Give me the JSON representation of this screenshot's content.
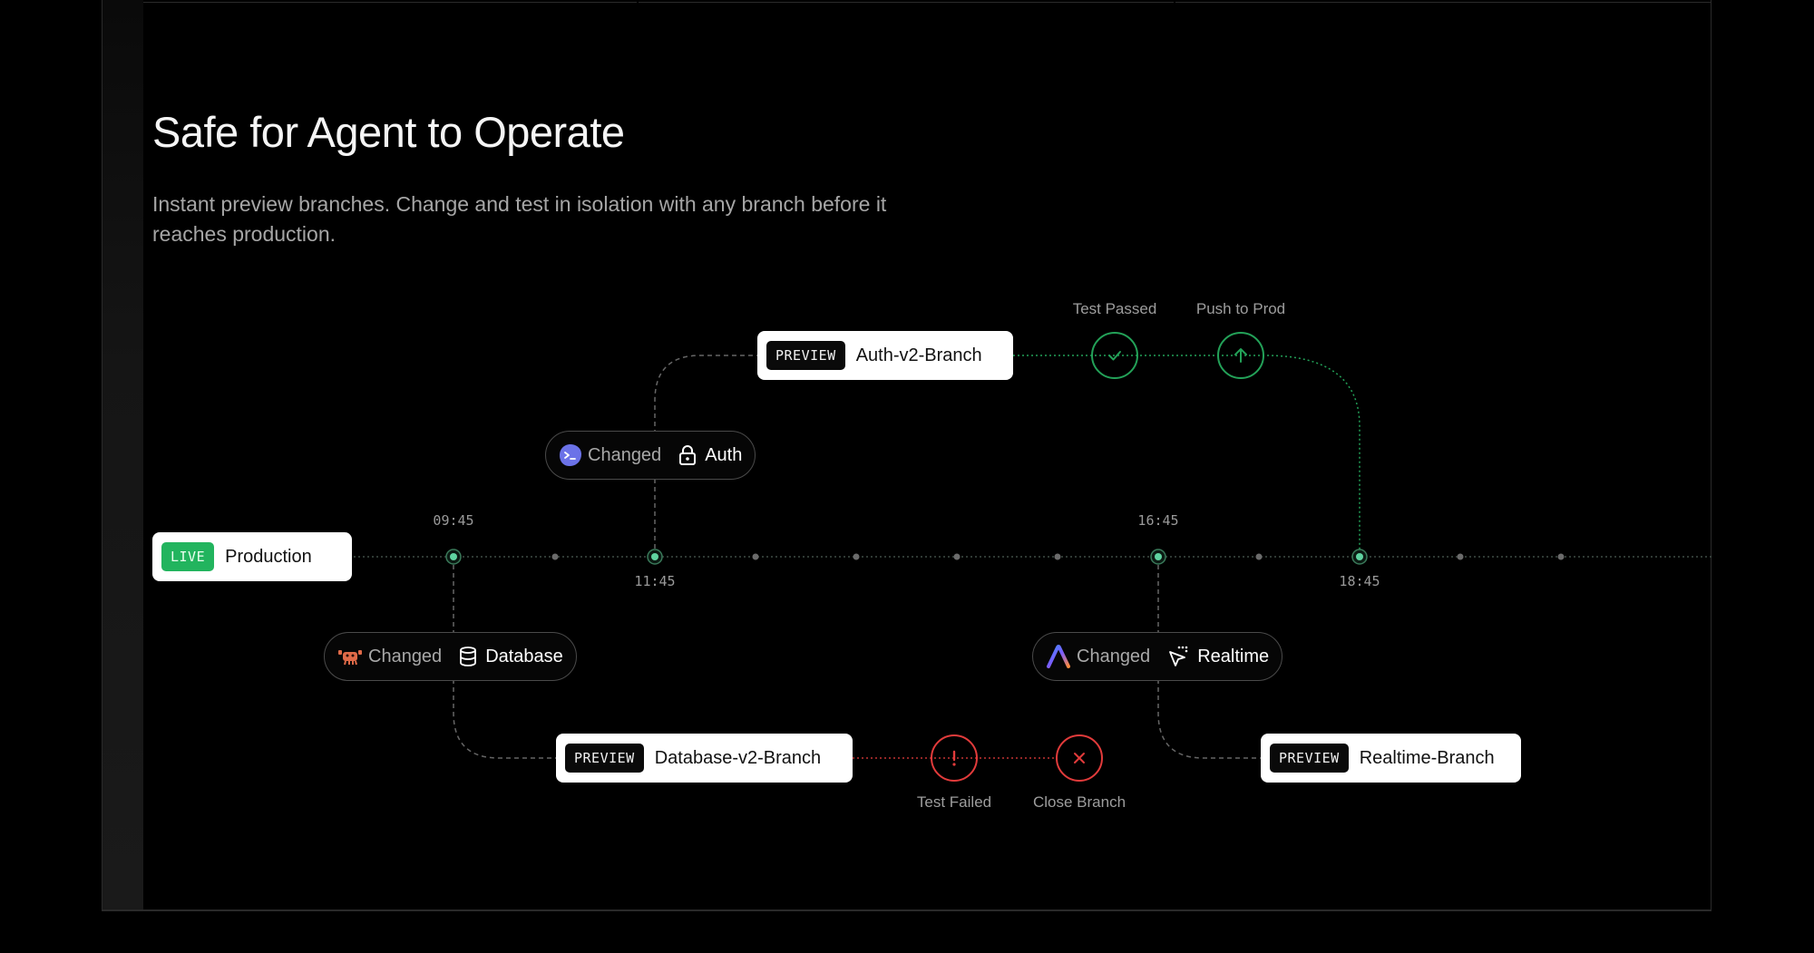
{
  "section": {
    "title": "Safe for Agent to Operate",
    "subtitle": "Instant preview branches. Change and test in isolation with any branch before it reaches production."
  },
  "timeline": {
    "times": {
      "t1": "09:45",
      "t2": "11:45",
      "t3": "16:45",
      "t4": "18:45"
    }
  },
  "production": {
    "tag": "LIVE",
    "label": "Production"
  },
  "changes": {
    "database": {
      "verb": "Changed",
      "target": "Database",
      "agent_icon": "crab-icon",
      "target_icon": "database-icon"
    },
    "auth": {
      "verb": "Changed",
      "target": "Auth",
      "agent_icon": "terminal-blob-icon",
      "target_icon": "lock-icon"
    },
    "realtime": {
      "verb": "Changed",
      "target": "Realtime",
      "agent_icon": "rainbow-a-icon",
      "target_icon": "cursor-sparkle-icon"
    }
  },
  "branches": {
    "database": {
      "tag": "PREVIEW",
      "label": "Database-v2-Branch"
    },
    "auth": {
      "tag": "PREVIEW",
      "label": "Auth-v2-Branch"
    },
    "realtime": {
      "tag": "PREVIEW",
      "label": "Realtime-Branch"
    }
  },
  "actions": {
    "test_passed": "Test Passed",
    "push_to_prod": "Push to Prod",
    "test_failed": "Test Failed",
    "close_branch": "Close Branch"
  },
  "colors": {
    "live": "#22b45e",
    "success": "#23a158",
    "danger": "#e23b3b",
    "dot": "#5fd3a0"
  }
}
